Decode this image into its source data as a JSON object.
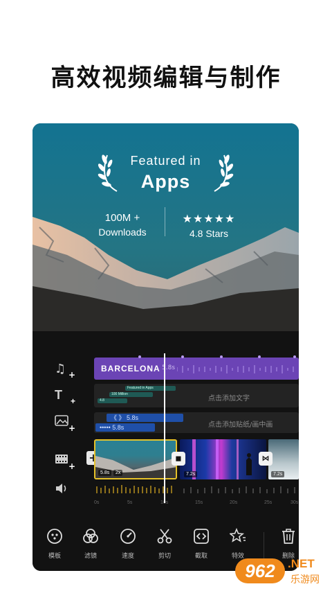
{
  "headline": "高效视频编辑与制作",
  "hero": {
    "featured_line1": "Featured in",
    "featured_line2": "Apps",
    "downloads_value": "100M +",
    "downloads_label": "Downloads",
    "stars": "★★★★★",
    "rating_label": "4.8 Stars"
  },
  "timeline": {
    "music_title": "BARCELONA",
    "music_duration": "5.8s",
    "text_clips": [
      "Featured in Apps ",
      "100 Million ",
      "4.8 "
    ],
    "text_hint": "点击添加文字",
    "sticker_clips": [
      "5.8s",
      "5.8s"
    ],
    "sticker_prefix": [
      "《 》",
      "•••••"
    ],
    "sticker_hint": "点击添加贴纸/画中画",
    "video_clip1_tags": [
      "5.8s",
      "2x"
    ],
    "video_clip2_tag": "7.2s",
    "video_clip3_tag": "7.2s",
    "add_button": "+",
    "ruler_ticks": [
      "0s",
      "5s",
      "10s",
      "15s",
      "20s",
      "25s",
      "30s"
    ]
  },
  "toolbar": {
    "items": [
      {
        "label": "模板",
        "icon": "template-icon"
      },
      {
        "label": "滤镜",
        "icon": "filter-icon"
      },
      {
        "label": "速度",
        "icon": "speed-icon"
      },
      {
        "label": "剪切",
        "icon": "scissors-icon"
      },
      {
        "label": "截取",
        "icon": "trim-icon"
      },
      {
        "label": "特效",
        "icon": "effects-icon"
      },
      {
        "label": "删除",
        "icon": "trash-icon"
      }
    ]
  },
  "watermark": {
    "brand": "962",
    "suffix": ".NET",
    "sub": "乐游网"
  },
  "colors": {
    "accent_purple": "#6b44b5",
    "sticker_blue": "#1f4fa8",
    "text_green": "#1f5a55",
    "selection_yellow": "#e6c229"
  }
}
